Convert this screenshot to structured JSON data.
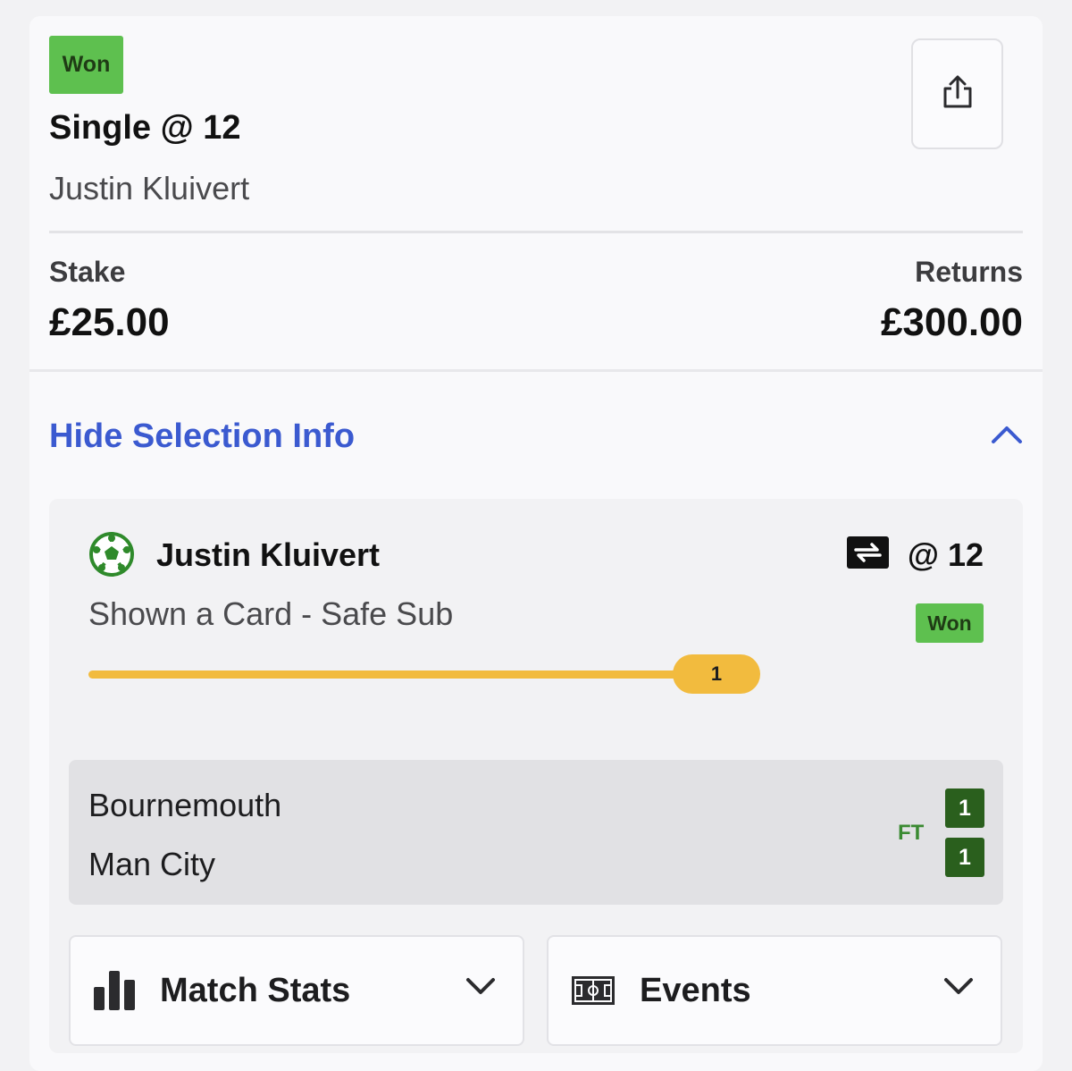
{
  "bet": {
    "status": "Won",
    "title": "Single @ 12",
    "selection_name": "Justin Kluivert"
  },
  "share": {
    "icon": "share-icon"
  },
  "stake": {
    "label": "Stake",
    "value": "£25.00"
  },
  "returns": {
    "label": "Returns",
    "value": "£300.00"
  },
  "selection_toggle": {
    "label": "Hide Selection Info",
    "icon": "chevron-up-icon"
  },
  "selection": {
    "sport_icon": "football-icon",
    "name": "Justin Kluivert",
    "cashout_icon": "swap-icon",
    "odds": "@ 12",
    "market": "Shown a Card - Safe Sub",
    "status": "Won",
    "progress_value": "1",
    "progress_fraction": 0.87
  },
  "match": {
    "home_team": "Bournemouth",
    "away_team": "Man City",
    "period": "FT",
    "home_score": "1",
    "away_score": "1"
  },
  "buttons": {
    "match_stats": "Match Stats",
    "events": "Events"
  },
  "colors": {
    "won_badge": "#5ec04f",
    "link_blue": "#3b5ad0",
    "progress": "#f2bb3e",
    "score_bg": "#2a5f1d",
    "ft_green": "#3a8a32"
  }
}
